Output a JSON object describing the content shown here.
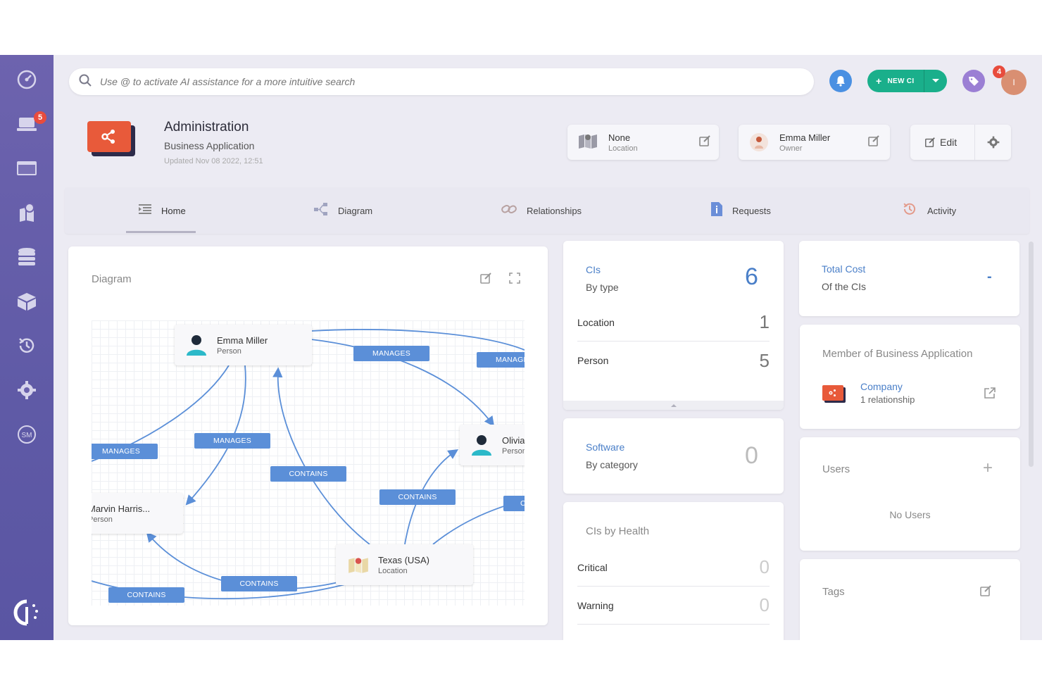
{
  "sidebar": {
    "badge_count": "5",
    "items": [
      {
        "icon": "dashboard-icon"
      },
      {
        "icon": "laptop-icon"
      },
      {
        "icon": "window-icon"
      },
      {
        "icon": "map-icon"
      },
      {
        "icon": "database-icon"
      },
      {
        "icon": "box-icon"
      },
      {
        "icon": "history-icon"
      },
      {
        "icon": "gear-icon"
      },
      {
        "icon": "sm-icon",
        "label": "SM"
      }
    ]
  },
  "header": {
    "search_placeholder": "Use @ to activate AI assistance for a more intuitive search",
    "new_ci_label": "NEW CI",
    "notification_badge": "4",
    "avatar_initial": "I"
  },
  "ci": {
    "title": "Administration",
    "type": "Business Application",
    "updated": "Updated Nov 08 2022, 12:51",
    "location_value": "None",
    "location_label": "Location",
    "owner_value": "Emma Miller",
    "owner_label": "Owner",
    "edit_label": "Edit"
  },
  "tabs": [
    {
      "label": "Home",
      "icon": "list-icon"
    },
    {
      "label": "Diagram",
      "icon": "diagram-icon"
    },
    {
      "label": "Relationships",
      "icon": "link-icon"
    },
    {
      "label": "Requests",
      "icon": "document-icon"
    },
    {
      "label": "Activity",
      "icon": "history-icon"
    }
  ],
  "diagram_panel": {
    "title": "Diagram",
    "nodes": [
      {
        "name": "Emma Miller",
        "type": "Person"
      },
      {
        "name": "Olivia",
        "type": "Person"
      },
      {
        "name": "Marvin Harris...",
        "type": "Person"
      },
      {
        "name": "Texas (USA)",
        "type": "Location"
      }
    ],
    "edge_labels": [
      "MANAGES",
      "MANAGES",
      "MANAGES",
      "MANAGES",
      "CONTAINS",
      "CONTAINS",
      "CONTAINS",
      "CONTAINS",
      "C"
    ]
  },
  "cis_card": {
    "title": "CIs",
    "subtitle": "By type",
    "total": "6",
    "rows": [
      {
        "label": "Location",
        "value": "1"
      },
      {
        "label": "Person",
        "value": "5"
      }
    ]
  },
  "software_card": {
    "title": "Software",
    "subtitle": "By category",
    "total": "0"
  },
  "health_card": {
    "title": "CIs by Health",
    "rows": [
      {
        "label": "Critical",
        "value": "0"
      },
      {
        "label": "Warning",
        "value": "0"
      }
    ]
  },
  "cost_card": {
    "title": "Total Cost",
    "subtitle": "Of the CIs",
    "value": "-"
  },
  "member_card": {
    "title": "Member of Business Application",
    "item_name": "Company",
    "item_sub": "1 relationship"
  },
  "users_card": {
    "title": "Users",
    "empty": "No Users"
  },
  "tags_card": {
    "title": "Tags"
  },
  "colors": {
    "sidebar": "#6d63ae",
    "accent_blue": "#4a7fc8",
    "new_ci_green": "#1aaf8b",
    "edge_label": "#5b8fd8",
    "badge_red": "#e84c3d",
    "app_icon": "#e85a3a"
  }
}
